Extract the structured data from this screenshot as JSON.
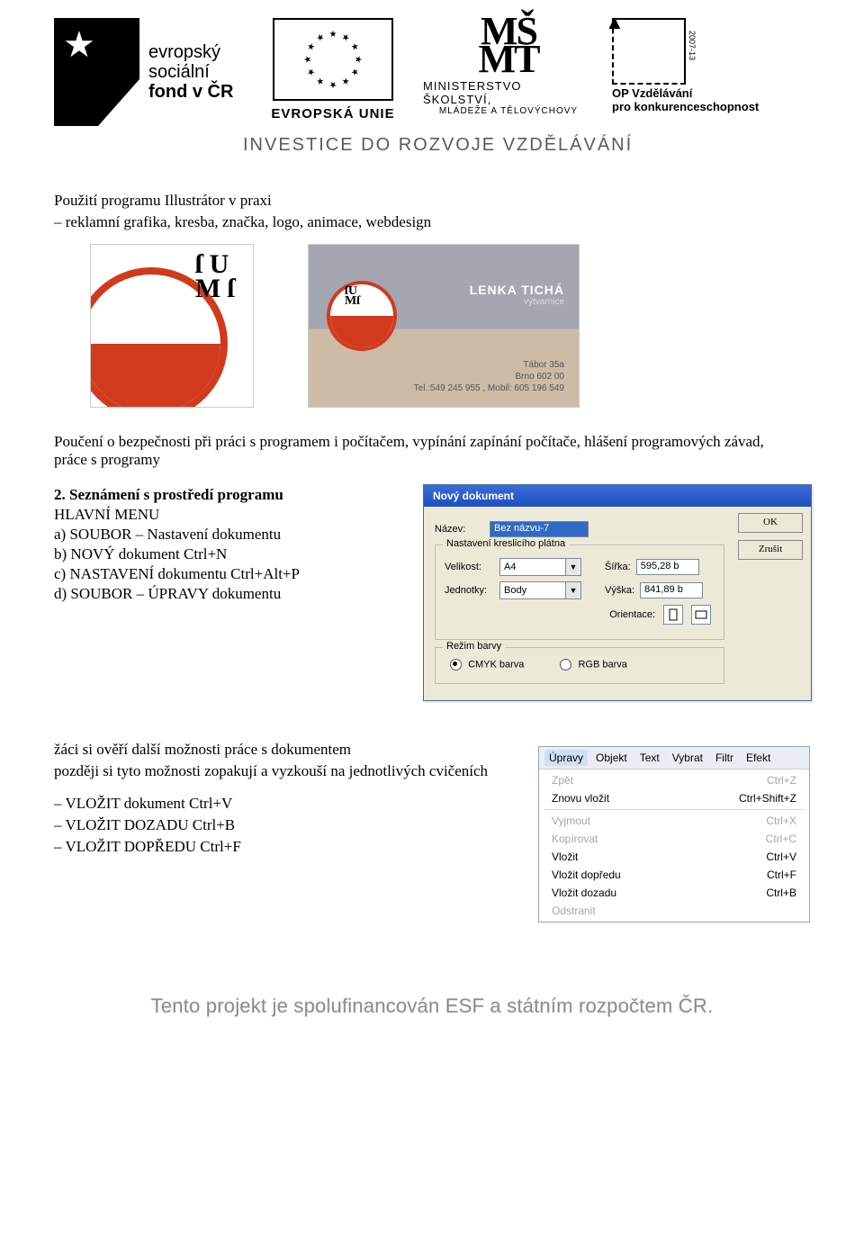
{
  "header": {
    "esf": {
      "l1": "evropský",
      "l2": "sociální",
      "l3": "fond v ČR"
    },
    "eu": {
      "label": "EVROPSKÁ UNIE"
    },
    "msmt": {
      "line1": "MINISTERSTVO ŠKOLSTVÍ,",
      "line2": "MLÁDEŽE A TĚLOVÝCHOVY"
    },
    "op": {
      "year": "2007-13",
      "l1": "OP Vzdělávání",
      "l2": "pro konkurenceschopnost"
    },
    "tagline": "INVESTICE DO ROZVOJE VZDĚLÁVÁNÍ"
  },
  "intro": {
    "title": "Použití programu Illustrátor v praxi",
    "bullet": "– reklamní grafika, kresba, značka, logo, animace, webdesign"
  },
  "card": {
    "name": "LENKA TICHÁ",
    "role": "výtvarnice",
    "addr1": "Tábor 35a",
    "addr2": "Brno 602 00",
    "tel": "Tel.:549 245 955 , Mobil:  605 196  549"
  },
  "safety": {
    "p1": "Poučení o bezpečnosti při práci s programem i počítačem, vypínání zapínání počítače, hlášení programových závad, práce s programy"
  },
  "sec2": {
    "heading": "2. Seznámení s prostředí programu",
    "sub": "HLAVNÍ MENU",
    "a": "a)  SOUBOR – Nastavení dokumentu",
    "b": "b)  NOVÝ dokument Ctrl+N",
    "c": "c) NASTAVENÍ  dokumentu Ctrl+Alt+P",
    "d": "d) SOUBOR – ÚPRAVY dokumentu"
  },
  "dialog": {
    "title": "Nový dokument",
    "name_lbl": "Název:",
    "name_val": "Bez názvu-7",
    "ok": "OK",
    "cancel": "Zrušit",
    "fs1": "Nastavení kreslicího plátna",
    "size_lbl": "Velikost:",
    "size_val": "A4",
    "units_lbl": "Jednotky:",
    "units_val": "Body",
    "width_lbl": "Šířka:",
    "width_val": "595,28 b",
    "height_lbl": "Výška:",
    "height_val": "841,89 b",
    "orient_lbl": "Orientace:",
    "fs2": "Režim barvy",
    "cmyk": "CMYK barva",
    "rgb": "RGB barva"
  },
  "followup": {
    "p1": "žáci si ověří další možnosti práce s dokumentem",
    "p2": "později si tyto možnosti zopakují a vyzkouší na jednotlivých cvičeních",
    "b1": "– VLOŽIT dokument Ctrl+V",
    "b2": "– VLOŽIT DOZADU Ctrl+B",
    "b3": "– VLOŽIT DOPŘEDU Ctrl+F"
  },
  "menubar": {
    "items": [
      "Úpravy",
      "Objekt",
      "Text",
      "Vybrat",
      "Filtr",
      "Efekt"
    ],
    "open_index": 0,
    "menu": [
      {
        "label": "Zpět",
        "shortcut": "Ctrl+Z",
        "disabled": true
      },
      {
        "label": "Znovu vložit",
        "shortcut": "Ctrl+Shift+Z",
        "disabled": false
      },
      {
        "sep": true
      },
      {
        "label": "Vyjmout",
        "shortcut": "Ctrl+X",
        "disabled": true
      },
      {
        "label": "Kopírovat",
        "shortcut": "Ctrl+C",
        "disabled": true
      },
      {
        "label": "Vložit",
        "shortcut": "Ctrl+V",
        "disabled": false
      },
      {
        "label": "Vložit dopředu",
        "shortcut": "Ctrl+F",
        "disabled": false
      },
      {
        "label": "Vložit dozadu",
        "shortcut": "Ctrl+B",
        "disabled": false
      },
      {
        "label": "Odstranit",
        "shortcut": "",
        "disabled": true
      }
    ]
  },
  "footer": "Tento projekt je spolufinancován ESF a státním rozpočtem ČR."
}
